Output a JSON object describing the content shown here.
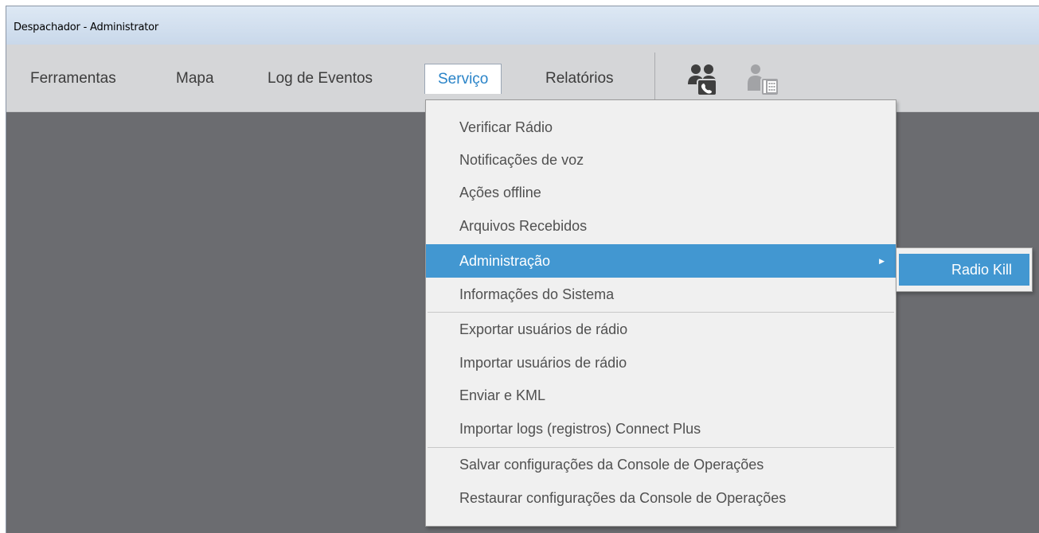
{
  "window": {
    "title": "Despachador - Administrator"
  },
  "menubar": {
    "items": [
      {
        "label": "Ferramentas"
      },
      {
        "label": "Mapa"
      },
      {
        "label": "Log de Eventos"
      },
      {
        "label": "Serviço",
        "active": true
      },
      {
        "label": "Relatórios"
      }
    ],
    "icons": [
      "dispatcher-call-icon",
      "dispatcher-phone-icon"
    ]
  },
  "dropdown": {
    "items": [
      {
        "label": "Verificar Rádio"
      },
      {
        "label": "Notificações de voz"
      },
      {
        "label": "Ações offline"
      },
      {
        "label": "Arquivos Recebidos"
      },
      {
        "label": "Administração",
        "highlighted": true,
        "has_submenu": true
      },
      {
        "label": "Informações do Sistema"
      },
      {
        "label": "Exportar usuários de rádio"
      },
      {
        "label": "Importar usuários de rádio"
      },
      {
        "label": "Enviar e KML"
      },
      {
        "label": "Importar logs (registros) Connect Plus"
      },
      {
        "label": "Salvar configurações da Console de Operações"
      },
      {
        "label": "Restaurar configurações da Console de Operações"
      }
    ]
  },
  "submenu": {
    "items": [
      {
        "label": "Radio Kill",
        "highlighted": true
      }
    ]
  },
  "colors": {
    "accent": "#4297d1",
    "active_tab_text": "#2a84c8",
    "workspace": "#6b6c70",
    "menubar": "#d5d6d8"
  }
}
